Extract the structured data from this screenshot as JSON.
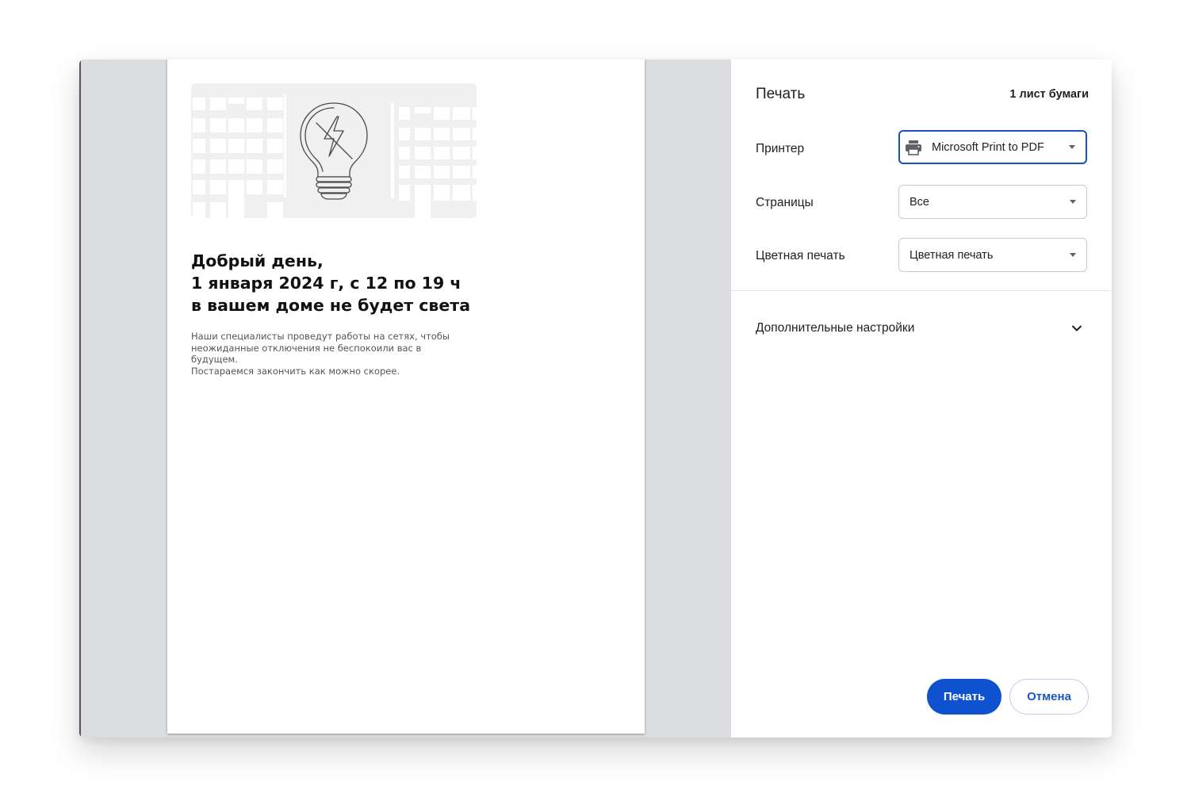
{
  "preview": {
    "headline": [
      "Добрый день,",
      "1 января 2024 г, с 12 по 19 ч",
      "в вашем доме не будет света"
    ],
    "body": [
      "Наши специалисты проведут работы на сетях, чтобы",
      "неожиданные отключения не беспокоили вас в",
      "будущем.",
      "Постараемся закончить как можно скорее."
    ],
    "illustration_icon": "lightbulb-no-power-icon"
  },
  "settings": {
    "title": "Печать",
    "sheets": "1 лист бумаги",
    "printer": {
      "label": "Принтер",
      "value": "Microsoft Print to PDF",
      "icon": "printer-icon"
    },
    "pages": {
      "label": "Страницы",
      "value": "Все"
    },
    "color": {
      "label": "Цветная печать",
      "value": "Цветная печать"
    },
    "advanced": {
      "label": "Дополнительные настройки",
      "icon": "chevron-down-icon"
    },
    "print_button": "Печать",
    "cancel_button": "Отмена"
  },
  "colors": {
    "primary": "#0f52d0",
    "focus_border": "#1a4ec8",
    "preview_background": "#dcdde0"
  }
}
